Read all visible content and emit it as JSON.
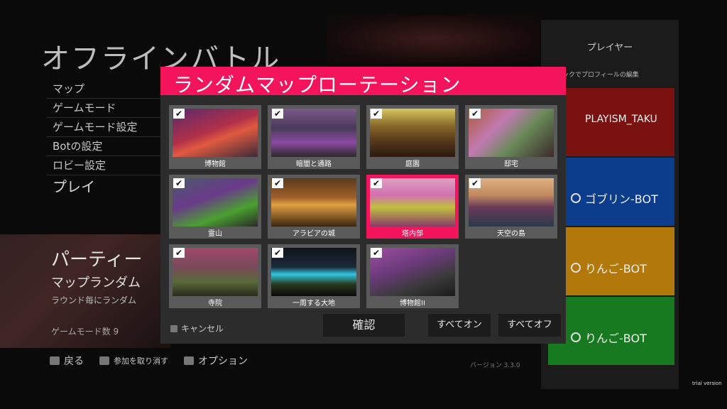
{
  "screen": {
    "title": "オフラインバトル",
    "menu": [
      "マップ",
      "ゲームモード",
      "ゲームモード設定",
      "Botの設定",
      "ロビー設定"
    ],
    "play_label": "プレイ",
    "party": {
      "title": "パーティー",
      "subtitle": "マップランダム",
      "desc": "ラウンド毎にランダム"
    },
    "mode_count": "ゲームモード数 9",
    "bottom": {
      "back": "戻る",
      "cancel_join": "参加を取り消す",
      "options": "オプション"
    },
    "version": "バージョン 3.3.0",
    "trial": "trial version"
  },
  "players": {
    "title": "プレイヤー",
    "edit_hint": "ックでプロフィールの編集",
    "list": [
      {
        "name": "PLAYISM_TAKU",
        "color": "#7a1212"
      },
      {
        "name": "ゴブリン-BOT",
        "color": "#0b3d8c"
      },
      {
        "name": "りんご-BOT",
        "color": "#b2780a"
      },
      {
        "name": "りんご-BOT",
        "color": "#177a20"
      }
    ]
  },
  "dialog": {
    "title": "ランダムマップローテーション",
    "maps": [
      {
        "label": "博物館",
        "checked": true,
        "selected": false
      },
      {
        "label": "暗闇と通路",
        "checked": true,
        "selected": false
      },
      {
        "label": "庭園",
        "checked": true,
        "selected": false
      },
      {
        "label": "邸宅",
        "checked": true,
        "selected": false
      },
      {
        "label": "霊山",
        "checked": true,
        "selected": false
      },
      {
        "label": "アラビアの城",
        "checked": true,
        "selected": false
      },
      {
        "label": "塔内部",
        "checked": true,
        "selected": true
      },
      {
        "label": "天空の島",
        "checked": true,
        "selected": false
      },
      {
        "label": "寺院",
        "checked": true,
        "selected": false
      },
      {
        "label": "一周する大地",
        "checked": true,
        "selected": false
      },
      {
        "label": "博物館II",
        "checked": true,
        "selected": false
      }
    ],
    "cancel_label": "キャンセル",
    "confirm_label": "確認",
    "all_on_label": "すべてオン",
    "all_off_label": "すべてオフ",
    "accent_color": "#f4145c"
  }
}
